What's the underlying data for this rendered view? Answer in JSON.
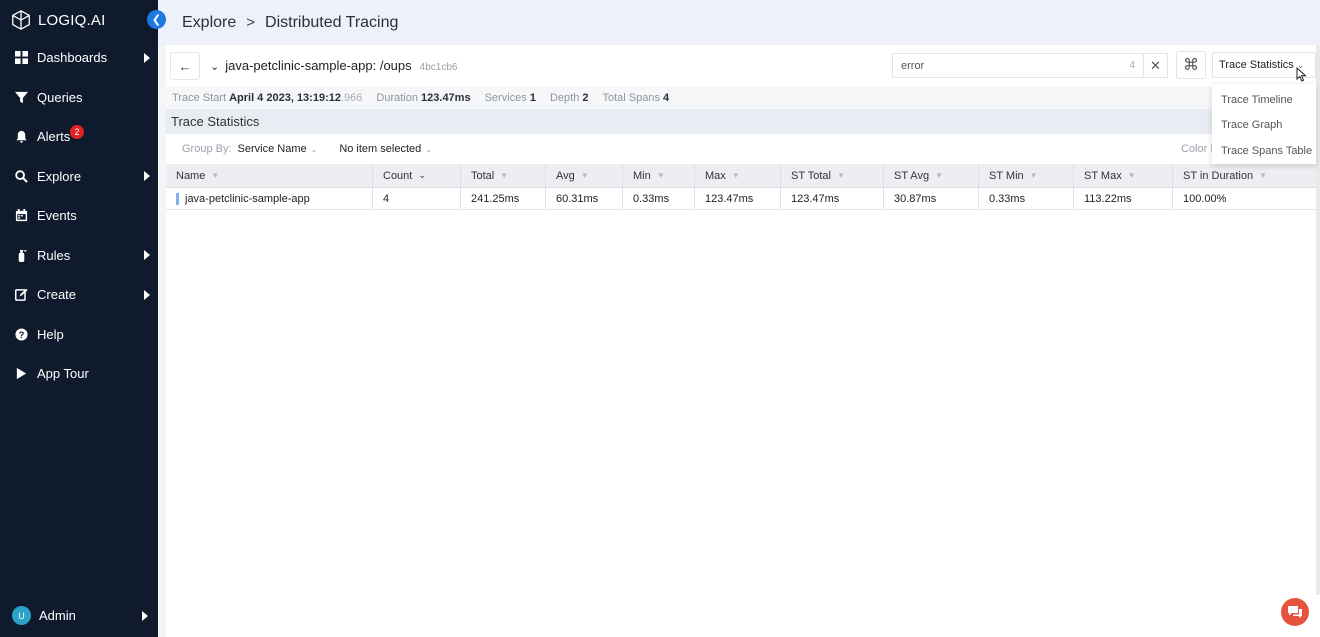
{
  "app": {
    "logo_text": "LOGIQ.AI"
  },
  "sidebar": {
    "items": [
      {
        "label": "Dashboards",
        "icon": "grid-icon",
        "has_submenu": true
      },
      {
        "label": "Queries",
        "icon": "filter-icon",
        "has_submenu": false
      },
      {
        "label": "Alerts",
        "icon": "bell-icon",
        "has_submenu": false,
        "badge": "2"
      },
      {
        "label": "Explore",
        "icon": "search-icon",
        "has_submenu": true
      },
      {
        "label": "Events",
        "icon": "calendar-icon",
        "has_submenu": false
      },
      {
        "label": "Rules",
        "icon": "fire-extinguisher-icon",
        "has_submenu": true
      },
      {
        "label": "Create",
        "icon": "edit-icon",
        "has_submenu": true
      },
      {
        "label": "Help",
        "icon": "question-circle-icon",
        "has_submenu": false
      },
      {
        "label": "App Tour",
        "icon": "play-icon",
        "has_submenu": false
      }
    ],
    "user": {
      "avatar_letter": "U",
      "label": "Admin"
    }
  },
  "header": {
    "crumbs": [
      "Explore",
      "Distributed Tracing"
    ],
    "separator": ">"
  },
  "trace": {
    "service_name": "java-petclinic-sample-app: /oups",
    "trace_id": "4bc1cb6",
    "search": {
      "value": "error",
      "count": "4"
    },
    "view_select": "Trace Statistics",
    "meta": {
      "start_label": "Trace Start",
      "start_value": "April 4 2023, 13:19:12",
      "start_frac": ".966",
      "duration_label": "Duration",
      "duration_value": "123.47ms",
      "services_label": "Services",
      "services_value": "1",
      "depth_label": "Depth",
      "depth_value": "2",
      "spans_label": "Total Spans",
      "spans_value": "4"
    }
  },
  "stats": {
    "title": "Trace Statistics",
    "group_by_label": "Group By:",
    "group_by_value": "Service Name",
    "secondary_value": "No item selected",
    "color_label": "Color I",
    "columns": [
      "Name",
      "Count",
      "Total",
      "Avg",
      "Min",
      "Max",
      "ST Total",
      "ST Avg",
      "ST Min",
      "ST Max",
      "ST in Duration"
    ],
    "rows": [
      [
        "java-petclinic-sample-app",
        "4",
        "241.25ms",
        "60.31ms",
        "0.33ms",
        "123.47ms",
        "123.47ms",
        "30.87ms",
        "0.33ms",
        "113.22ms",
        "100.00%"
      ]
    ]
  },
  "dropdown": {
    "items": [
      "Trace Timeline",
      "Trace Graph",
      "Trace Spans Table"
    ]
  },
  "colors": {
    "sidebar_bg": "#0f1b2d",
    "accent": "#1f7ae0",
    "badge": "#e02424",
    "chat": "#e5533d"
  }
}
